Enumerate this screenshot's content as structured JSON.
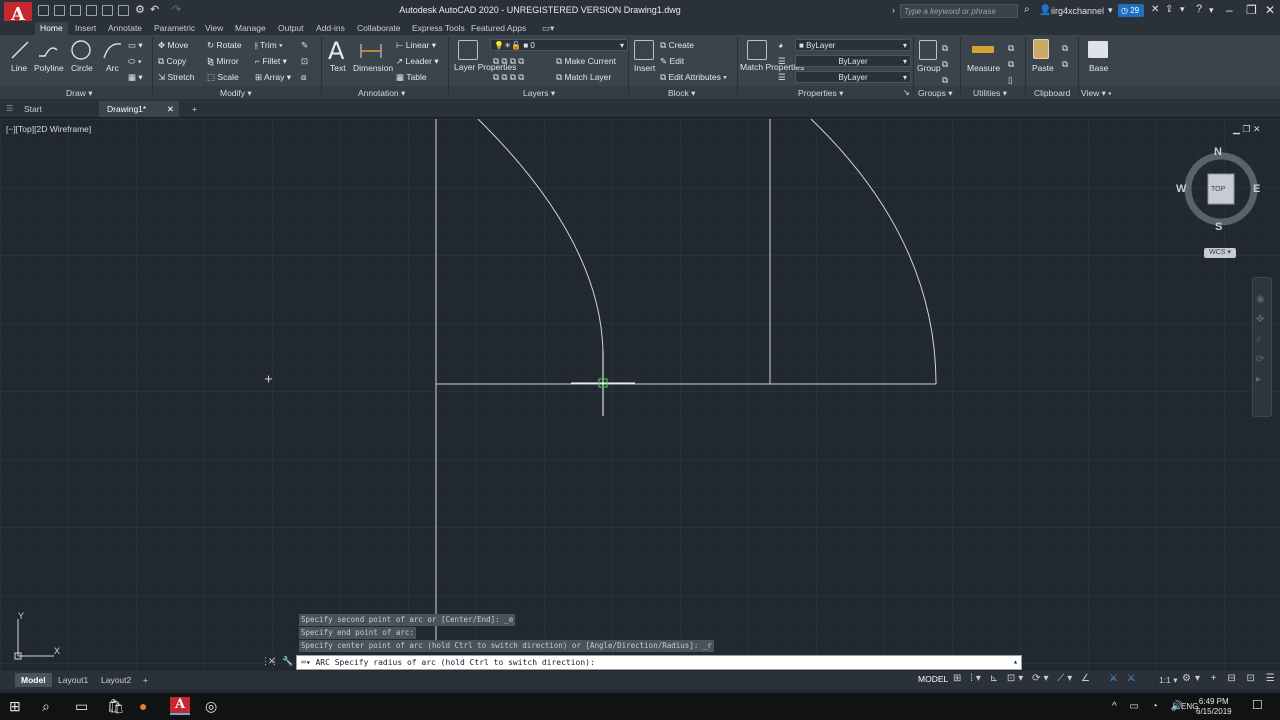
{
  "app": {
    "logo_letter": "A",
    "window_title": "Autodesk AutoCAD 2020 - UNREGISTERED VERSION    Drawing1.dwg",
    "search_placeholder": "Type a keyword or phrase",
    "username": "iirg4xchannel",
    "notification_count": "29"
  },
  "ribbon_tabs": [
    "Home",
    "Insert",
    "Annotate",
    "Parametric",
    "View",
    "Manage",
    "Output",
    "Add-ins",
    "Collaborate",
    "Express Tools",
    "Featured Apps"
  ],
  "panels": {
    "draw": {
      "title": "Draw",
      "line": "Line",
      "polyline": "Polyline",
      "circle": "Circle",
      "arc": "Arc"
    },
    "modify": {
      "title": "Modify",
      "move": "Move",
      "rotate": "Rotate",
      "trim": "Trim",
      "copy": "Copy",
      "mirror": "Mirror",
      "fillet": "Fillet",
      "stretch": "Stretch",
      "scale": "Scale",
      "array": "Array"
    },
    "annotation": {
      "title": "Annotation",
      "text": "Text",
      "dimension": "Dimension",
      "linear": "Linear",
      "leader": "Leader",
      "table": "Table"
    },
    "layers": {
      "title": "Layers",
      "layer_properties": "Layer Properties",
      "current_layer": "0",
      "make_current": "Make Current",
      "match_layer": "Match Layer"
    },
    "block": {
      "title": "Block",
      "insert": "Insert",
      "create": "Create",
      "edit": "Edit",
      "edit_attributes": "Edit Attributes"
    },
    "properties": {
      "title": "Properties",
      "match_properties": "Match Properties",
      "color": "ByLayer",
      "linetype": "ByLayer",
      "lineweight": "ByLayer"
    },
    "groups": {
      "title": "Groups",
      "group": "Group"
    },
    "utilities": {
      "title": "Utilities",
      "measure": "Measure"
    },
    "clipboard": {
      "title": "Clipboard",
      "paste": "Paste"
    },
    "view": {
      "title": "View",
      "base": "Base"
    }
  },
  "doc_tabs": {
    "start": "Start",
    "drawing": "Drawing1*"
  },
  "viewport_label": "[−][Top][2D Wireframe]",
  "viewcube": {
    "n": "N",
    "s": "S",
    "e": "E",
    "w": "W",
    "face": "TOP",
    "ucs": "WCS"
  },
  "ucs_icon": {
    "x": "X",
    "y": "Y"
  },
  "command_history": [
    "Specify second point of arc or [Center/End]: _e",
    "Specify end point of arc:",
    "Specify center point of arc (hold Ctrl to switch direction) or [Angle/Direction/Radius]: _r"
  ],
  "command_line": "ARC Specify radius of arc (hold Ctrl to switch direction):",
  "layout_tabs": [
    "Model",
    "Layout1",
    "Layout2"
  ],
  "status": {
    "model": "MODEL",
    "scale": "1:1"
  },
  "taskbar": {
    "time": "6:49 PM",
    "date": "6/15/2019",
    "lang": "ENG"
  }
}
